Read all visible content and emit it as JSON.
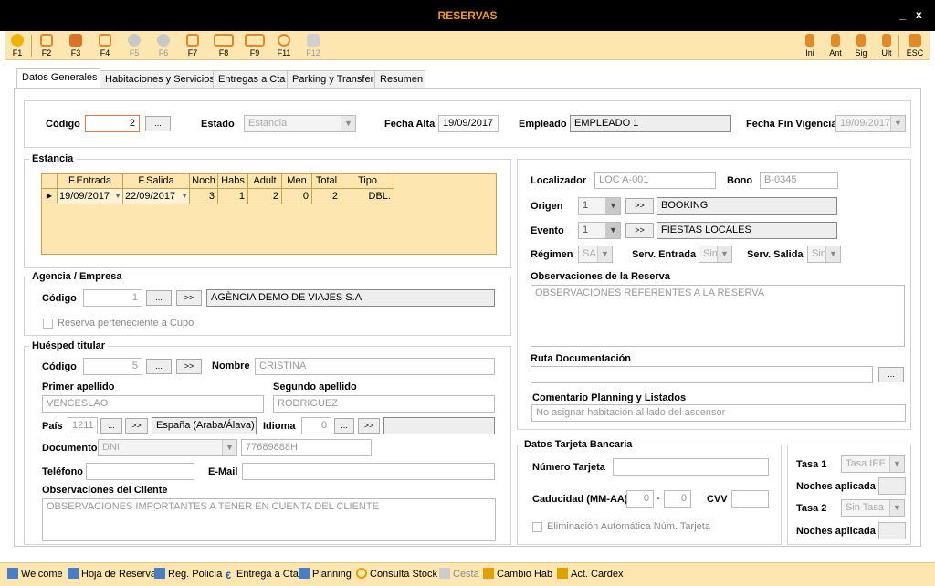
{
  "window": {
    "title": "RESERVAS",
    "minimize": "_",
    "close": "x"
  },
  "toolbar": {
    "items": [
      {
        "label": "F1",
        "icon": "help-icon",
        "enabled": true
      },
      {
        "label": "F2",
        "icon": "trash-icon",
        "enabled": true
      },
      {
        "label": "F3",
        "icon": "print-icon",
        "enabled": true
      },
      {
        "label": "F4",
        "icon": "edit-icon",
        "enabled": true
      },
      {
        "label": "F5",
        "icon": "download-icon",
        "enabled": false
      },
      {
        "label": "F6",
        "icon": "cancel-icon",
        "enabled": false
      },
      {
        "label": "F7",
        "icon": "document-icon",
        "enabled": true
      },
      {
        "label": "F8",
        "icon": "calendar-icon",
        "enabled": true
      },
      {
        "label": "F9",
        "icon": "keyboard-icon",
        "enabled": true
      },
      {
        "label": "F11",
        "icon": "search-icon",
        "enabled": true
      },
      {
        "label": "F12",
        "icon": "settings-icon",
        "enabled": false
      }
    ],
    "nav": [
      {
        "label": "Ini",
        "icon": "first-icon"
      },
      {
        "label": "Ant",
        "icon": "prev-icon"
      },
      {
        "label": "Sig",
        "icon": "next-icon"
      },
      {
        "label": "Ult",
        "icon": "last-icon"
      }
    ],
    "exit": {
      "label": "ESC",
      "icon": "exit-icon"
    }
  },
  "tabs": [
    "Datos Generales",
    "Habitaciones y Servicios",
    "Entregas a Cta",
    "Parking y Transfer",
    "Resumen"
  ],
  "header": {
    "codigo_label": "Código",
    "codigo_value": "2",
    "estado_label": "Estado",
    "estado_value": "Estancia",
    "fecha_alta_label": "Fecha Alta",
    "fecha_alta_value": "19/09/2017",
    "empleado_label": "Empleado",
    "empleado_value": "EMPLEADO 1",
    "fecha_fin_label": "Fecha Fin Vigencia",
    "fecha_fin_value": "19/09/2017",
    "ellipsis": "..."
  },
  "estancia": {
    "title": "Estancia",
    "columns": [
      "F.Entrada",
      "F.Salida",
      "Noch",
      "Habs",
      "Adult",
      "Men",
      "Total",
      "Tipo"
    ],
    "row": [
      "19/09/2017",
      "22/09/2017",
      "3",
      "1",
      "2",
      "0",
      "2",
      "DBL."
    ],
    "row_marker": "▶"
  },
  "agencia": {
    "title": "Agencia / Empresa",
    "codigo_label": "Código",
    "codigo_value": "1",
    "name_value": "AGÈNCIA DEMO DE VIAJES S.A",
    "cupo_label": "Reserva perteneciente a Cupo"
  },
  "huesped": {
    "title": "Huésped titular",
    "codigo_label": "Código",
    "codigo_value": "5",
    "nombre_label": "Nombre",
    "nombre_value": "CRISTINA",
    "primer_label": "Primer apellido",
    "primer_value": "VENCESLAO",
    "segundo_label": "Segundo apellido",
    "segundo_value": "RODRIGUEZ",
    "pais_label": "País",
    "pais_code": "1211",
    "pais_value": "España (Araba/Álava)",
    "idioma_label": "Idioma",
    "idioma_code": "0",
    "documento_label": "Documento",
    "documento_type": "DNI",
    "documento_value": "77689888H",
    "telefono_label": "Teléfono",
    "email_label": "E-Mail",
    "obs_label": "Observaciones del Cliente",
    "obs_value": "OBSERVACIONES IMPORTANTES A TENER EN CUENTA DEL CLIENTE"
  },
  "reserva": {
    "localizador_label": "Localizador",
    "localizador_value": "LOC A-001",
    "bono_label": "Bono",
    "bono_value": "B-0345",
    "origen_label": "Origen",
    "origen_code": "1",
    "origen_value": "BOOKING",
    "evento_label": "Evento",
    "evento_code": "1",
    "evento_value": "FIESTAS LOCALES",
    "regimen_label": "Régimen",
    "regimen_value": "SA",
    "serv_entrada_label": "Serv. Entrada",
    "serv_entrada_value": "Sin",
    "serv_salida_label": "Serv. Salida",
    "serv_salida_value": "Sin",
    "obs_label": "Observaciones de la Reserva",
    "obs_value": "OBSERVACIONES REFERENTES  A  LA RESERVA",
    "ruta_label": "Ruta Documentación",
    "comentario_label": "Comentario Planning y Listados",
    "comentario_value": "No asignar habitación al lado del ascensor",
    "goto": ">>"
  },
  "tarjeta": {
    "title": "Datos Tarjeta Bancaria",
    "numero_label": "Número Tarjeta",
    "caducidad_label": "Caducidad (MM-AA)",
    "mm": "0",
    "aa": "0",
    "dash": "-",
    "cvv_label": "CVV",
    "elim_label": "Eliminación Automática Núm. Tarjeta"
  },
  "tasas": {
    "tasa1_label": "Tasa 1",
    "tasa1_value": "Tasa IEE",
    "noches1_label": "Noches aplicada",
    "tasa2_label": "Tasa 2",
    "tasa2_value": "Sin Tasa",
    "noches2_label": "Noches aplicada"
  },
  "statusbar": [
    {
      "label": "Welcome",
      "icon": "form-icon",
      "enabled": true
    },
    {
      "label": "Hoja de Reserva",
      "icon": "sheet-icon",
      "enabled": true
    },
    {
      "label": "Reg. Policía",
      "icon": "register-icon",
      "enabled": true
    },
    {
      "label": "Entrega a Cta",
      "icon": "euro-icon",
      "enabled": true
    },
    {
      "label": "Planning",
      "icon": "planning-icon",
      "enabled": true
    },
    {
      "label": "Consulta Stock",
      "icon": "search-icon",
      "enabled": true
    },
    {
      "label": "Cesta",
      "icon": "basket-icon",
      "enabled": false
    },
    {
      "label": "Cambio Hab",
      "icon": "swap-icon",
      "enabled": true
    },
    {
      "label": "Act. Cardex",
      "icon": "cardex-icon",
      "enabled": true
    }
  ],
  "colors": {
    "accent": "#f39c12",
    "toolbar_bg": "#fde6b0",
    "grid_border": "#c8a14e",
    "titlebar_bg": "#000000"
  }
}
